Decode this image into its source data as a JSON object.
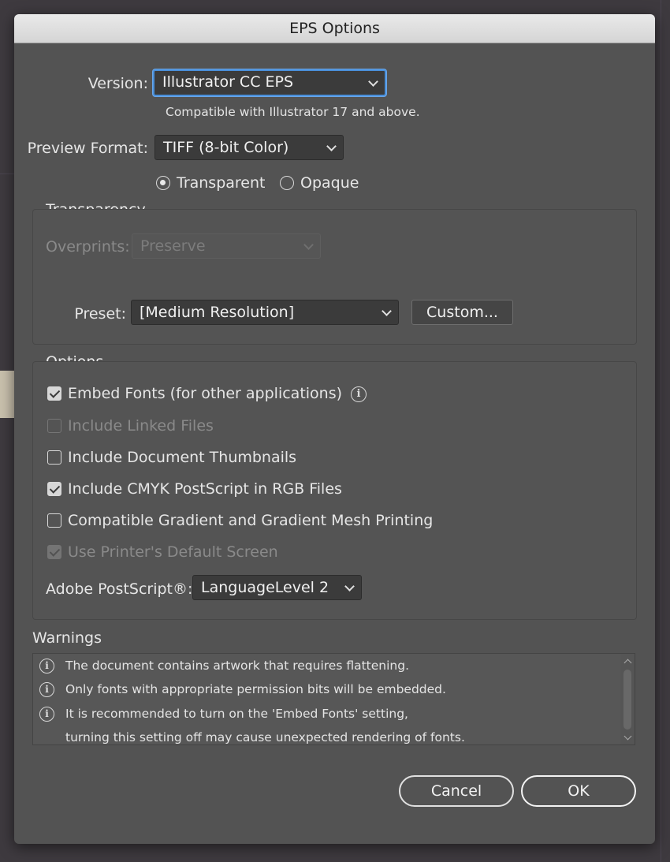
{
  "dialog": {
    "title": "EPS Options"
  },
  "version": {
    "label": "Version:",
    "value": "Illustrator CC EPS",
    "note": "Compatible with Illustrator 17 and above."
  },
  "preview": {
    "label": "Preview Format:",
    "value": "TIFF (8-bit Color)",
    "radios": [
      {
        "label": "Transparent",
        "selected": true
      },
      {
        "label": "Opaque",
        "selected": false
      }
    ]
  },
  "transparency": {
    "heading": "Transparency",
    "overprints_label": "Overprints:",
    "overprints_value": "Preserve",
    "preset_label": "Preset:",
    "preset_value": "[Medium Resolution]",
    "custom_button": "Custom..."
  },
  "options": {
    "heading": "Options",
    "checks": [
      {
        "label": "Embed Fonts (for other applications)",
        "checked": true,
        "enabled": true
      },
      {
        "label": "Include Linked Files",
        "checked": false,
        "enabled": false
      },
      {
        "label": "Include Document Thumbnails",
        "checked": false,
        "enabled": true
      },
      {
        "label": "Include CMYK PostScript in RGB Files",
        "checked": true,
        "enabled": true
      },
      {
        "label": "Compatible Gradient and Gradient Mesh Printing",
        "checked": false,
        "enabled": true
      },
      {
        "label": "Use Printer's Default Screen",
        "checked": true,
        "enabled": false
      }
    ],
    "postscript_label": "Adobe PostScript®:",
    "postscript_value": "LanguageLevel 2"
  },
  "warnings": {
    "heading": "Warnings",
    "items": [
      "The document contains artwork that requires flattening.",
      "Only fonts with appropriate permission bits will be embedded.",
      "It is recommended to turn on the 'Embed Fonts' setting,",
      "turning this setting off may cause unexpected rendering of fonts."
    ]
  },
  "buttons": {
    "cancel": "Cancel",
    "ok": "OK"
  },
  "icons": {
    "info": "info-icon",
    "chevron": "chevron-down-icon"
  },
  "colors": {
    "dialog_bg": "#535353",
    "focus_ring": "#4a8fd9",
    "titlebar": "#dedede"
  }
}
